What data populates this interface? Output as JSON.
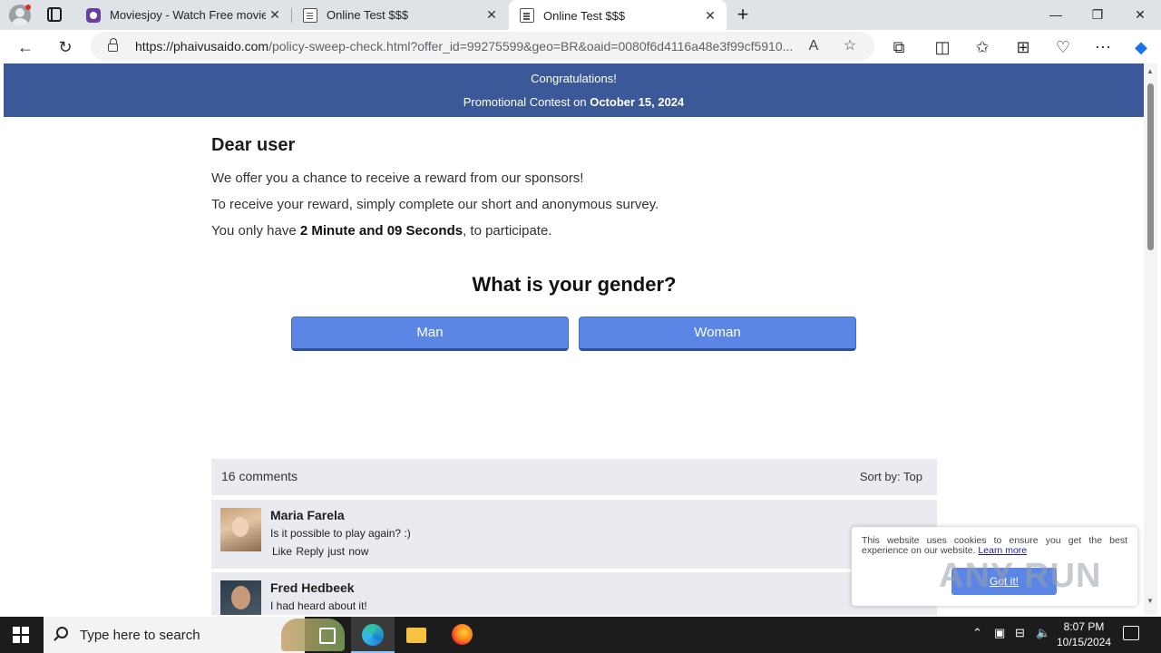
{
  "browser": {
    "tabs": [
      {
        "title": "Moviesjoy - Watch Free movies &",
        "icon": "movie-icon"
      },
      {
        "title": "Online Test $$$",
        "icon": "document-icon"
      },
      {
        "title": "Online Test $$$",
        "icon": "document-icon",
        "active": true
      }
    ],
    "url_host": "https://phaivusaido.com",
    "url_path": "/policy-sweep-check.html?offer_id=99275599&geo=BR&oaid=0080f6d4116a48e3f99cf5910...",
    "window_controls": {
      "minimize": "—",
      "maximize": "❐",
      "close": "✕"
    }
  },
  "banner": {
    "line1": "Congratulations!",
    "line2_prefix": "Promotional Contest on ",
    "line2_date": "October 15, 2024",
    "color": "#3b5998"
  },
  "intro": {
    "heading": "Dear user",
    "line1": "We offer you a chance to receive a reward from our sponsors!",
    "line2": "To receive your reward, simply complete our short and anonymous survey.",
    "line3_prefix": "You only have ",
    "line3_time": "2 Minute and 09 Seconds",
    "line3_suffix": ", to participate."
  },
  "survey": {
    "question": "What is your gender?",
    "options": [
      "Man",
      "Woman"
    ],
    "button_color": "#5b86e5"
  },
  "comments": {
    "count_label": "16 comments",
    "sort_label": "Sort by:  Top",
    "items": [
      {
        "name": "Maria Farela",
        "text": "Is it possible to play again? :)",
        "meta": "Like Reply  just now"
      },
      {
        "name": "Fred Hedbeek",
        "text": "I had heard about it!",
        "meta": ""
      }
    ]
  },
  "cookie": {
    "text": "This website uses cookies to ensure you get the best experience on our website.",
    "learn_more": "Learn more",
    "button": "Got it!",
    "watermark": "ANY RUN"
  },
  "taskbar": {
    "search_placeholder": "Type here to search",
    "time": "8:07 PM",
    "date": "10/15/2024"
  }
}
